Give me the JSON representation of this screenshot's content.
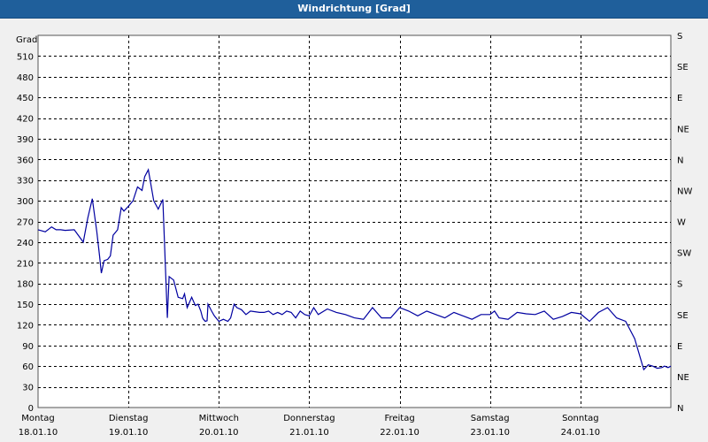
{
  "window": {
    "title": "Windrichtung [Grad]"
  },
  "chart_data": {
    "type": "line",
    "title": "Windrichtung [Grad]",
    "ylabel": "Grad",
    "ylim": [
      0,
      540
    ],
    "yticks": [
      0,
      30,
      60,
      90,
      120,
      150,
      180,
      210,
      240,
      270,
      300,
      330,
      360,
      390,
      420,
      450,
      480,
      510
    ],
    "right_ticks": [
      "N",
      "NE",
      "E",
      "SE",
      "S",
      "SW",
      "W",
      "NW",
      "N",
      "NE",
      "E",
      "SE",
      "S"
    ],
    "xlim": [
      0,
      7
    ],
    "days": [
      {
        "day": "Montag",
        "date": "18.01.10"
      },
      {
        "day": "Dienstag",
        "date": "19.01.10"
      },
      {
        "day": "Mittwoch",
        "date": "20.01.10"
      },
      {
        "day": "Donnerstag",
        "date": "21.01.10"
      },
      {
        "day": "Freitag",
        "date": "22.01.10"
      },
      {
        "day": "Samstag",
        "date": "23.01.10"
      },
      {
        "day": "Sonntag",
        "date": "24.01.10"
      }
    ],
    "grid": true,
    "line_color": "#0000a0",
    "series": [
      {
        "x": [
          0,
          0.08,
          0.15,
          0.2,
          0.25,
          0.3,
          0.4,
          0.5,
          0.55,
          0.6,
          0.65,
          0.68,
          0.7,
          0.73,
          0.77,
          0.8,
          0.83,
          0.88,
          0.92,
          0.95,
          1.0,
          1.05,
          1.1,
          1.15,
          1.18,
          1.22,
          1.28,
          1.33,
          1.38,
          1.43,
          1.45,
          1.5,
          1.55,
          1.6,
          1.62,
          1.65,
          1.7,
          1.74,
          1.77,
          1.8,
          1.82,
          1.83,
          1.85,
          1.87,
          1.88,
          1.9,
          1.92,
          1.95,
          2.0,
          2.05,
          2.1,
          2.13,
          2.17,
          2.2,
          2.25,
          2.3,
          2.35,
          2.45,
          2.5,
          2.55,
          2.6,
          2.65,
          2.7,
          2.75,
          2.8,
          2.85,
          2.9,
          2.95,
          3.0,
          3.05,
          3.1,
          3.2,
          3.3,
          3.4,
          3.5,
          3.6,
          3.7,
          3.8,
          3.9,
          4.0,
          4.1,
          4.2,
          4.3,
          4.4,
          4.5,
          4.6,
          4.7,
          4.8,
          4.9,
          5.0,
          5.05,
          5.1,
          5.2,
          5.3,
          5.4,
          5.5,
          5.6,
          5.7,
          5.8,
          5.9,
          6.0,
          6.1,
          6.2,
          6.3,
          6.4,
          6.5,
          6.6,
          6.7,
          6.75,
          6.8,
          6.85,
          6.9,
          6.93,
          6.97,
          7.0
        ],
        "y": [
          258,
          255,
          262,
          258,
          258,
          257,
          258,
          240,
          275,
          303,
          255,
          220,
          195,
          213,
          215,
          220,
          250,
          258,
          290,
          285,
          292,
          300,
          320,
          315,
          335,
          345,
          300,
          288,
          302,
          130,
          190,
          185,
          160,
          158,
          165,
          145,
          160,
          148,
          150,
          140,
          130,
          128,
          125,
          126,
          150,
          145,
          140,
          133,
          125,
          128,
          125,
          130,
          150,
          145,
          142,
          135,
          140,
          138,
          138,
          140,
          135,
          138,
          135,
          140,
          138,
          130,
          140,
          135,
          133,
          145,
          135,
          143,
          138,
          135,
          130,
          128,
          145,
          130,
          130,
          145,
          140,
          133,
          140,
          135,
          130,
          138,
          133,
          128,
          135,
          135,
          140,
          130,
          128,
          138,
          136,
          135,
          140,
          128,
          132,
          138,
          136,
          125,
          138,
          145,
          130,
          125,
          100,
          55,
          62,
          60,
          57,
          58,
          60,
          58,
          60
        ],
        "note": "x in days from Montag 18.01.10"
      }
    ]
  }
}
